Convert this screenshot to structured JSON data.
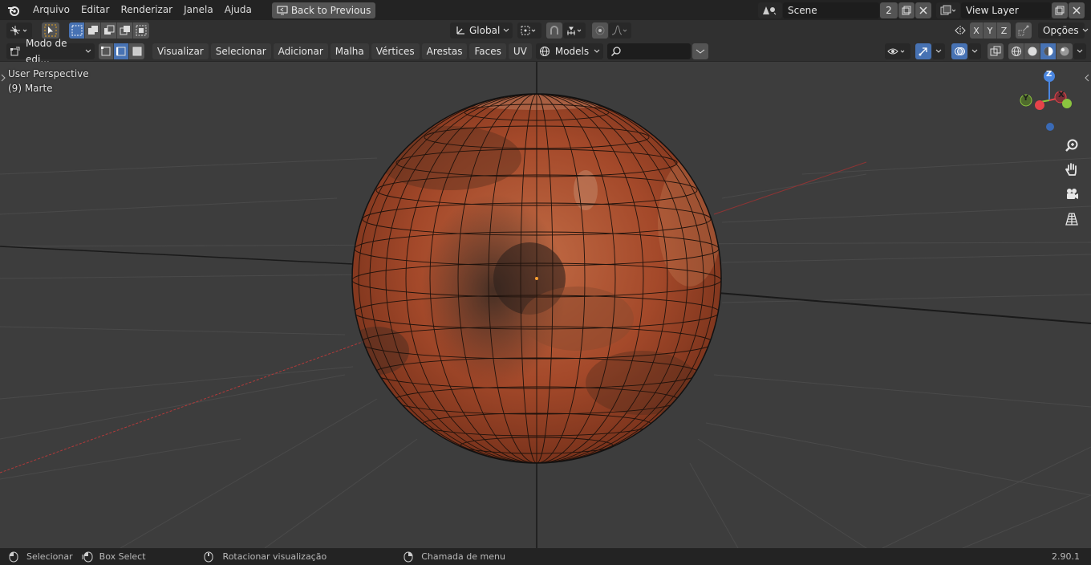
{
  "topbar": {
    "menus": [
      "Arquivo",
      "Editar",
      "Renderizar",
      "Janela",
      "Ajuda"
    ],
    "back_button": "Back to Previous",
    "scene_name": "Scene",
    "scene_users": "2",
    "view_layer": "View Layer"
  },
  "toolbar1": {
    "transform_orientation": "Global",
    "axes": [
      "X",
      "Y",
      "Z"
    ],
    "options_label": "Opções"
  },
  "toolbar2": {
    "mode_label": "Modo de edi...",
    "menus": [
      "Visualizar",
      "Selecionar",
      "Adicionar",
      "Malha",
      "Vértices",
      "Arestas",
      "Faces",
      "UV"
    ],
    "collection": "Models",
    "search_placeholder": ""
  },
  "viewport": {
    "perspective_label": "User Perspective",
    "object_label": "(9) Marte",
    "gizmo_axes": {
      "z": "Z",
      "y": "Y",
      "x": "X"
    }
  },
  "statusbar": {
    "items": [
      "Selecionar",
      "Box Select",
      "Rotacionar visualização",
      "Chamada de menu"
    ],
    "version": "2.90.1"
  },
  "colors": {
    "accent": "#4772b3",
    "planet": "#b0532f",
    "x_axis": "#e5434a",
    "y_axis": "#8bc43f",
    "z_axis": "#4a86e0"
  }
}
